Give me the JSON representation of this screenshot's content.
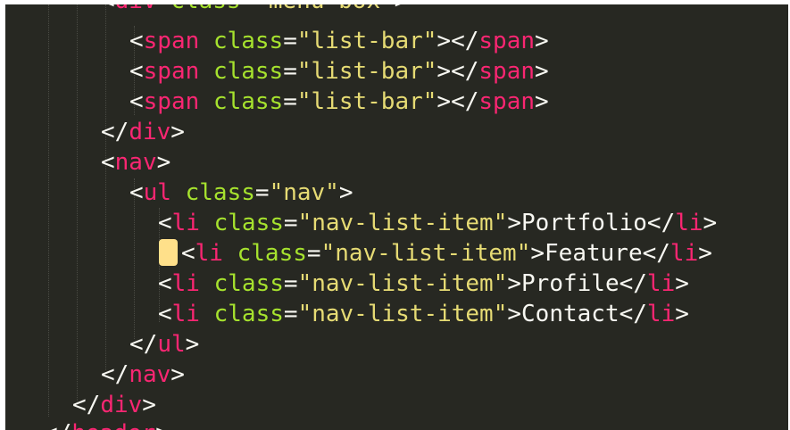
{
  "theme": {
    "background": "#272822",
    "tag_color": "#f92672",
    "attr_color": "#a6e22e",
    "string_color": "#e6db74",
    "text_color": "#f8f8f2",
    "cursor_color": "#ffe08a"
  },
  "code": {
    "lines": [
      {
        "tag": "div",
        "attr": "class",
        "value": "\"menu-box\""
      },
      {
        "tag": "span",
        "attr": "class",
        "value": "\"list-bar\"",
        "close_tag": "span"
      },
      {
        "tag": "span",
        "attr": "class",
        "value": "\"list-bar\"",
        "close_tag": "span"
      },
      {
        "tag": "span",
        "attr": "class",
        "value": "\"list-bar\"",
        "close_tag": "span"
      },
      {
        "close_tag": "div"
      },
      {
        "tag": "nav"
      },
      {
        "tag": "ul",
        "attr": "class",
        "value": "\"nav\""
      },
      {
        "tag": "li",
        "attr": "class",
        "value": "\"nav-list-item\"",
        "text": "Portfolio",
        "close_tag": "li"
      },
      {
        "tag": "li",
        "attr": "class",
        "value": "\"nav-list-item\"",
        "text": "Feature",
        "close_tag": "li"
      },
      {
        "tag": "li",
        "attr": "class",
        "value": "\"nav-list-item\"",
        "text": "Profile",
        "close_tag": "li"
      },
      {
        "tag": "li",
        "attr": "class",
        "value": "\"nav-list-item\"",
        "text": "Contact",
        "close_tag": "li"
      },
      {
        "close_tag": "ul"
      },
      {
        "close_tag": "nav"
      },
      {
        "close_tag": "div"
      },
      {
        "close_tag": "header"
      }
    ]
  }
}
